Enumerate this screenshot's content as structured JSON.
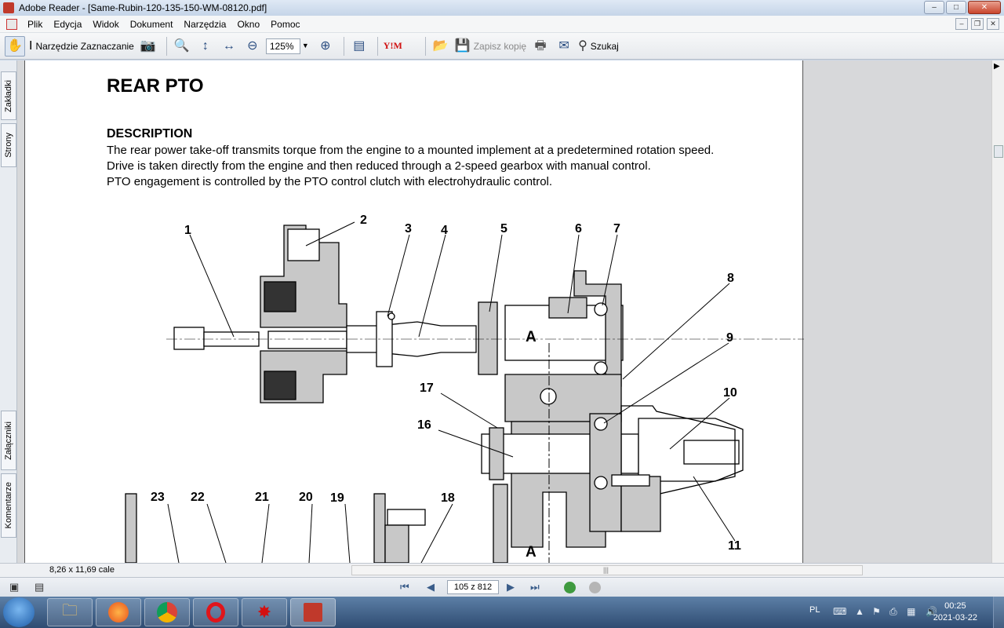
{
  "window": {
    "title": "Adobe Reader - [Same-Rubin-120-135-150-WM-08120.pdf]",
    "minimize": "–",
    "maximize": "□",
    "close": "✕"
  },
  "menu": {
    "items": [
      "Plik",
      "Edycja",
      "Widok",
      "Dokument",
      "Narzędzia",
      "Okno",
      "Pomoc"
    ]
  },
  "toolbar": {
    "select_tool_label": "Narzędzie Zaznaczanie",
    "zoom_value": "125%",
    "save_copy_label": "Zapisz kopię",
    "search_label": "Szukaj",
    "ya_label": "Y!M"
  },
  "sidetabs": [
    "Zakładki",
    "Strony",
    "Załączniki",
    "Komentarze"
  ],
  "document": {
    "heading": "REAR PTO",
    "subheading": "DESCRIPTION",
    "lines": [
      "The rear power take-off transmits torque from the engine to a mounted implement at a predetermined rotation speed.",
      "Drive is taken directly from the engine and then reduced through a 2-speed gearbox with manual control.",
      "PTO engagement is controlled by the PTO control clutch with electrohydraulic control."
    ],
    "diagram_labels": [
      "1",
      "2",
      "3",
      "4",
      "5",
      "6",
      "7",
      "8",
      "9",
      "10",
      "11",
      "16",
      "17",
      "18",
      "19",
      "20",
      "21",
      "22",
      "23",
      "A",
      "A"
    ]
  },
  "status": {
    "page_size": "8,26 x 11,69 cale"
  },
  "navigation": {
    "page_indicator": "105 z 812"
  },
  "taskbar": {
    "lang": "PL",
    "time": "00:25",
    "date": "2021-03-22"
  },
  "colors": {
    "accent": "#2a4d80",
    "page_bg": "#ffffff",
    "viewer_bg": "#d7d8da",
    "diagram_fill": "#c8c8c8"
  }
}
